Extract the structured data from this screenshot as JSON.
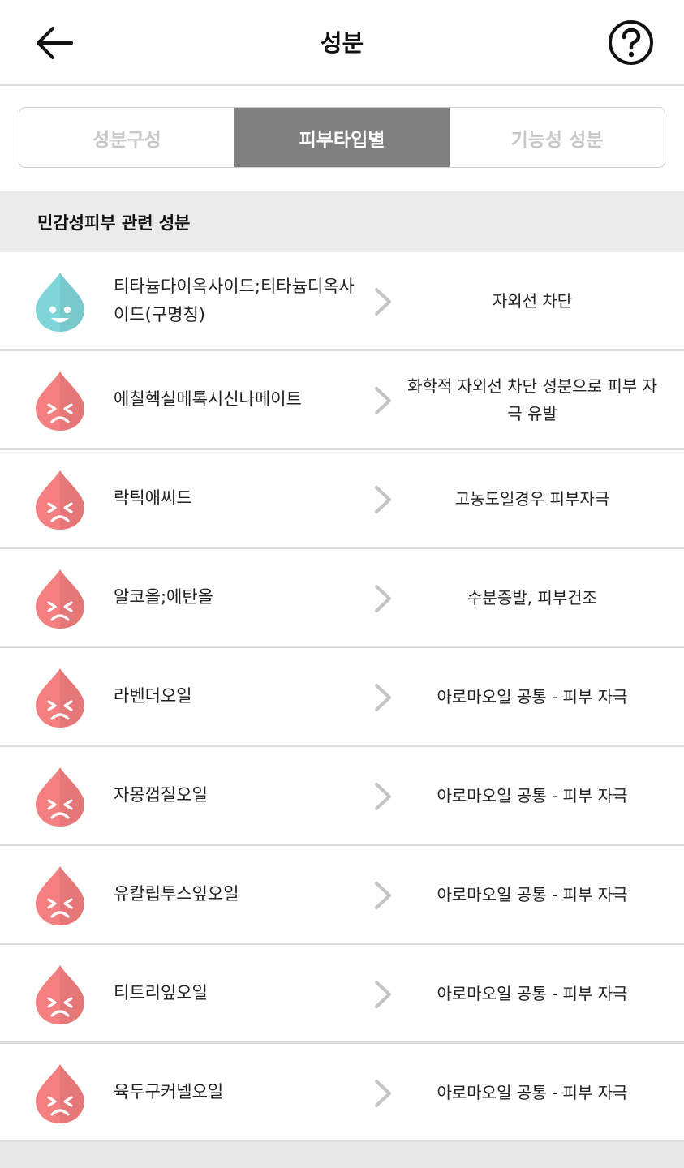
{
  "header": {
    "title": "성분",
    "back_icon": "arrow-left-icon",
    "help_icon": "question-circle-icon"
  },
  "tabs": [
    {
      "label": "성분구성",
      "active": false
    },
    {
      "label": "피부타입별",
      "active": true
    },
    {
      "label": "기능성 성분",
      "active": false
    }
  ],
  "section": {
    "title": "민감성피부 관련 성분"
  },
  "colors": {
    "good": "#7fd6d8",
    "bad": "#f47f80",
    "tab_active": "#808080"
  },
  "items": [
    {
      "name": "티타늄다이옥사이드;티타늄디옥사이드(구명칭)",
      "description": "자외선 차단",
      "rating": "good",
      "icon": "happy-drop-icon"
    },
    {
      "name": "에칠헥실메톡시신나메이트",
      "description": "화학적 자외선 차단 성분으로 피부 자극 유발",
      "rating": "bad",
      "icon": "sad-drop-icon"
    },
    {
      "name": "락틱애씨드",
      "description": "고농도일경우 피부자극",
      "rating": "bad",
      "icon": "sad-drop-icon"
    },
    {
      "name": "알코올;에탄올",
      "description": "수분증발, 피부건조",
      "rating": "bad",
      "icon": "sad-drop-icon"
    },
    {
      "name": "라벤더오일",
      "description": "아로마오일 공통 - 피부 자극",
      "rating": "bad",
      "icon": "sad-drop-icon"
    },
    {
      "name": "자몽껍질오일",
      "description": "아로마오일 공통 - 피부 자극",
      "rating": "bad",
      "icon": "sad-drop-icon"
    },
    {
      "name": "유칼립투스잎오일",
      "description": "아로마오일 공통 - 피부 자극",
      "rating": "bad",
      "icon": "sad-drop-icon"
    },
    {
      "name": "티트리잎오일",
      "description": "아로마오일 공통 - 피부 자극",
      "rating": "bad",
      "icon": "sad-drop-icon"
    },
    {
      "name": "육두구커넬오일",
      "description": "아로마오일 공통 - 피부 자극",
      "rating": "bad",
      "icon": "sad-drop-icon"
    }
  ]
}
